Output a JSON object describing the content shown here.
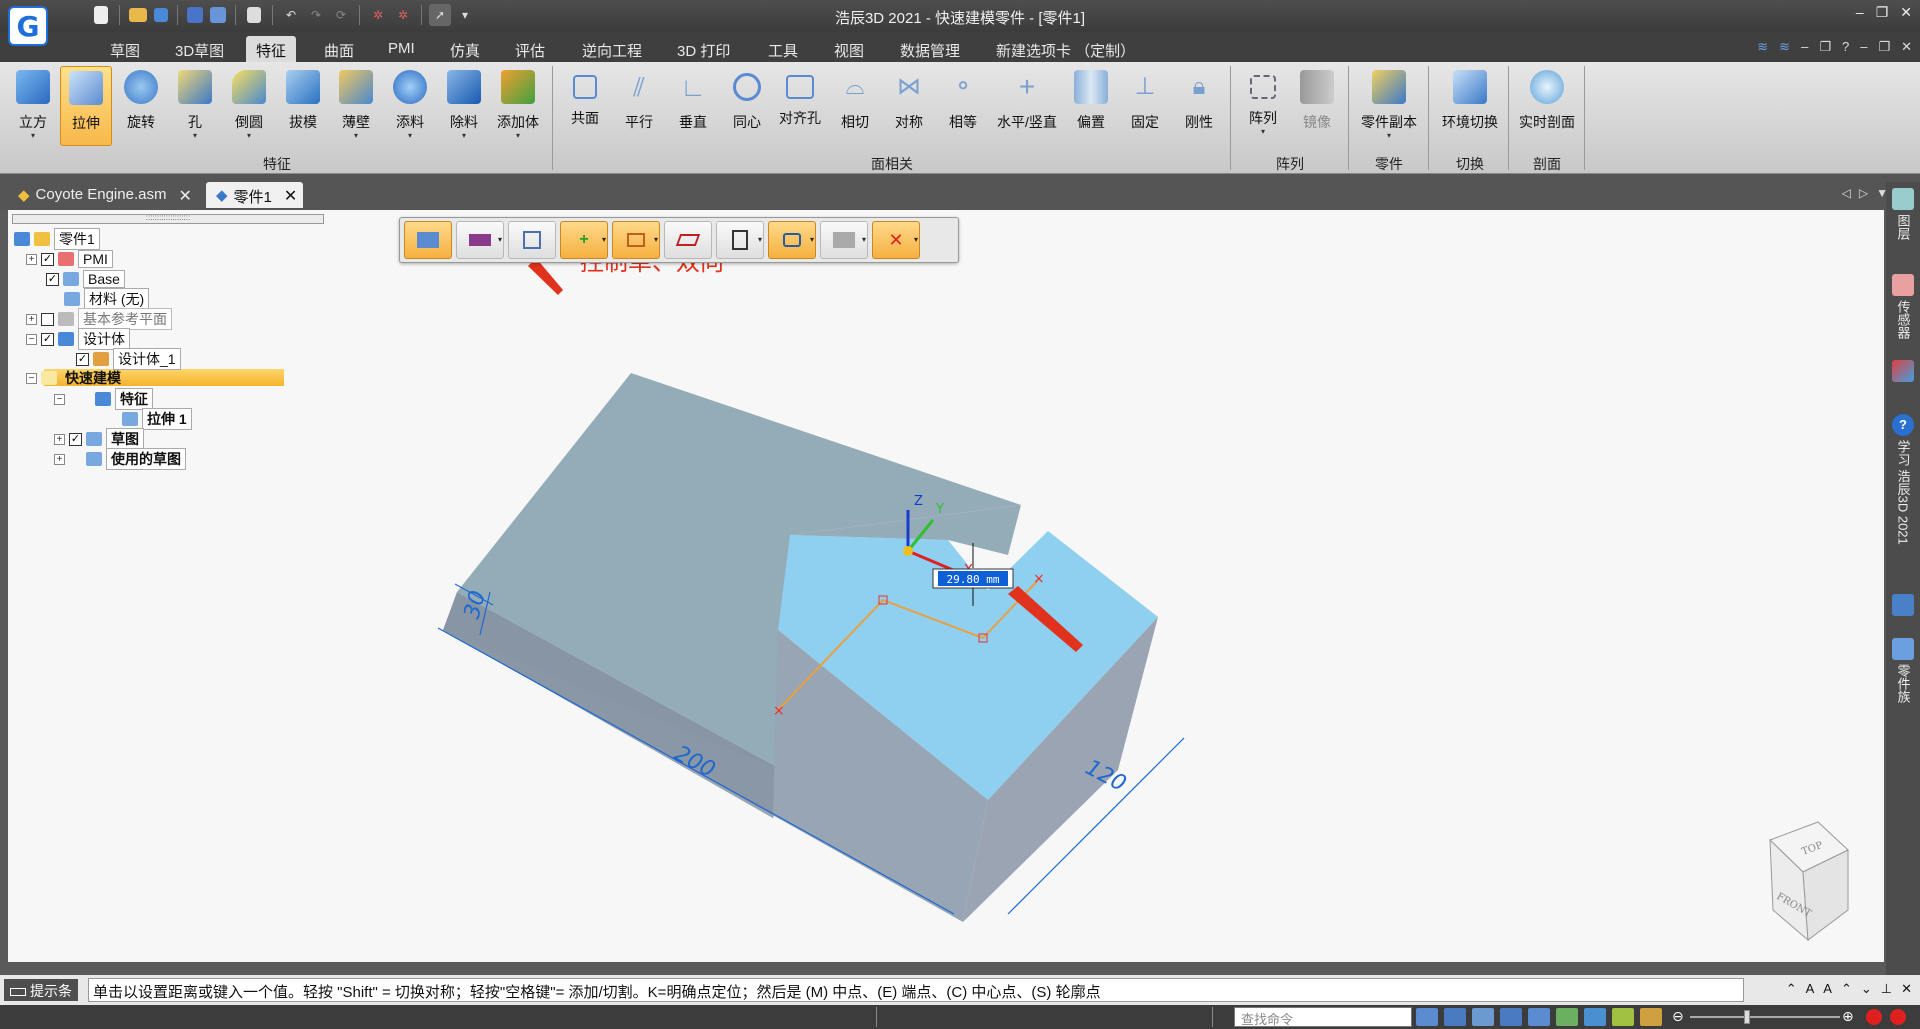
{
  "window": {
    "title": "浩辰3D 2021 - 快速建模零件 - [零件1]"
  },
  "ribbon_tabs": [
    "草图",
    "3D草图",
    "特征",
    "曲面",
    "PMI",
    "仿真",
    "评估",
    "逆向工程",
    "3D 打印",
    "工具",
    "视图",
    "数据管理",
    "新建选项卡 （定制）"
  ],
  "ribbon_active_tab": "特征",
  "feature_buttons": [
    "立方",
    "拉伸",
    "旋转",
    "孔",
    "倒圆",
    "拔模",
    "薄壁",
    "添料",
    "除料",
    "添加体"
  ],
  "face_buttons": [
    "共面",
    "平行",
    "垂直",
    "同心",
    "对齐孔",
    "相切",
    "对称",
    "相等",
    "水平/竖直",
    "偏置",
    "固定",
    "刚性"
  ],
  "pattern_buttons": [
    "阵列",
    "镜像"
  ],
  "other_buttons": [
    "零件副本",
    "环境切换",
    "实时剖面"
  ],
  "group_labels": {
    "features": "特征",
    "face": "面相关",
    "pattern": "阵列",
    "part": "零件",
    "switch": "切换",
    "section": "剖面"
  },
  "doc_tabs": [
    "Coyote Engine.asm",
    "零件1"
  ],
  "tree": {
    "root": "零件1",
    "pmi": "PMI",
    "base": "Base",
    "material": "材料 (无)",
    "ref_planes": "基本参考平面",
    "design_body": "设计体",
    "design_body_1": "设计体_1",
    "quick_model": "快速建模",
    "features": "特征",
    "extrude": "拉伸 1",
    "sketch": "草图",
    "used_sketch": "使用的草图"
  },
  "annotation": "控制单、双向",
  "dimensions": {
    "height": "30",
    "length": "200",
    "width": "120",
    "input": "29.80 mm"
  },
  "axis_labels": {
    "z": "Z",
    "y": "Y",
    "x": "X"
  },
  "viewcube": {
    "top": "TOP",
    "front": "FRONT"
  },
  "right_panel": [
    "图层",
    "传感器",
    "学习 浩辰3D 2021",
    "零件族"
  ],
  "prompt": {
    "label": "提示条",
    "text": "单击以设置距离或键入一个值。轻按 \"Shift\" = 切换对称；轻按\"空格键\"= 添加/切割。K=明确点定位；然后是 (M) 中点、(E) 端点、(C) 中心点、(S) 轮廓点"
  },
  "status": {
    "search_placeholder": "查找命令"
  },
  "colors": {
    "active_tab": "#dcdcdc",
    "highlight": "#f4b32e",
    "annotation": "#e0321c",
    "top_face": "#93adb8",
    "selected_face": "#8fd0f2",
    "side_face": "#9aa7b3"
  }
}
